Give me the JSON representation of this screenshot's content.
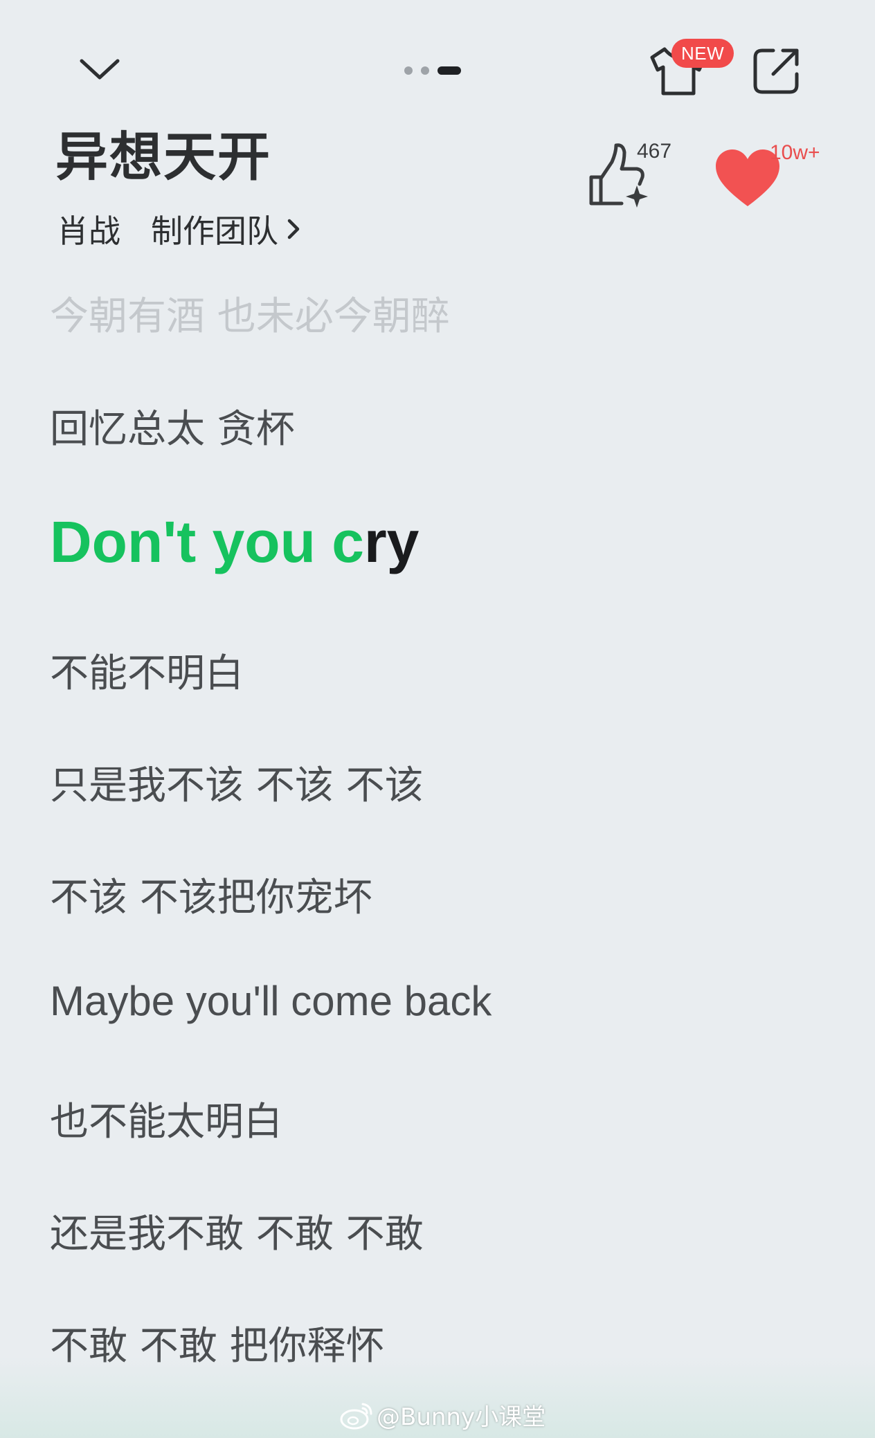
{
  "header": {
    "collapse_icon": "chevron-down-icon",
    "skin_icon": "tshirt-icon",
    "new_badge": "NEW",
    "share_icon": "share-icon"
  },
  "song": {
    "title": "异想天开",
    "artist": "肖战",
    "team": "制作团队"
  },
  "stats": {
    "like_count": "467",
    "fav_count": "10w+",
    "like_icon": "thumb-up-sparkle-icon",
    "fav_icon": "heart-icon",
    "heart_color": "#f25252"
  },
  "lyrics": {
    "past_line": "今朝有酒 也未必今朝醉",
    "line_1": "回忆总太 贪杯",
    "current_sung": "Don't you c",
    "current_rest": "ry",
    "line_3": "不能不明白",
    "line_4": "只是我不该 不该 不该",
    "line_5": "不该 不该把你宠坏",
    "line_6": "Maybe you'll come back",
    "line_7": "也不能太明白",
    "line_8": "还是我不敢 不敢 不敢",
    "line_9": "不敢 不敢 把你释怀"
  },
  "watermark": {
    "text": "@Bunny小课堂",
    "icon": "weibo-icon"
  },
  "colors": {
    "accent_green": "#16c25e",
    "background": "#e9edf0",
    "badge_red": "#f14a4a"
  }
}
